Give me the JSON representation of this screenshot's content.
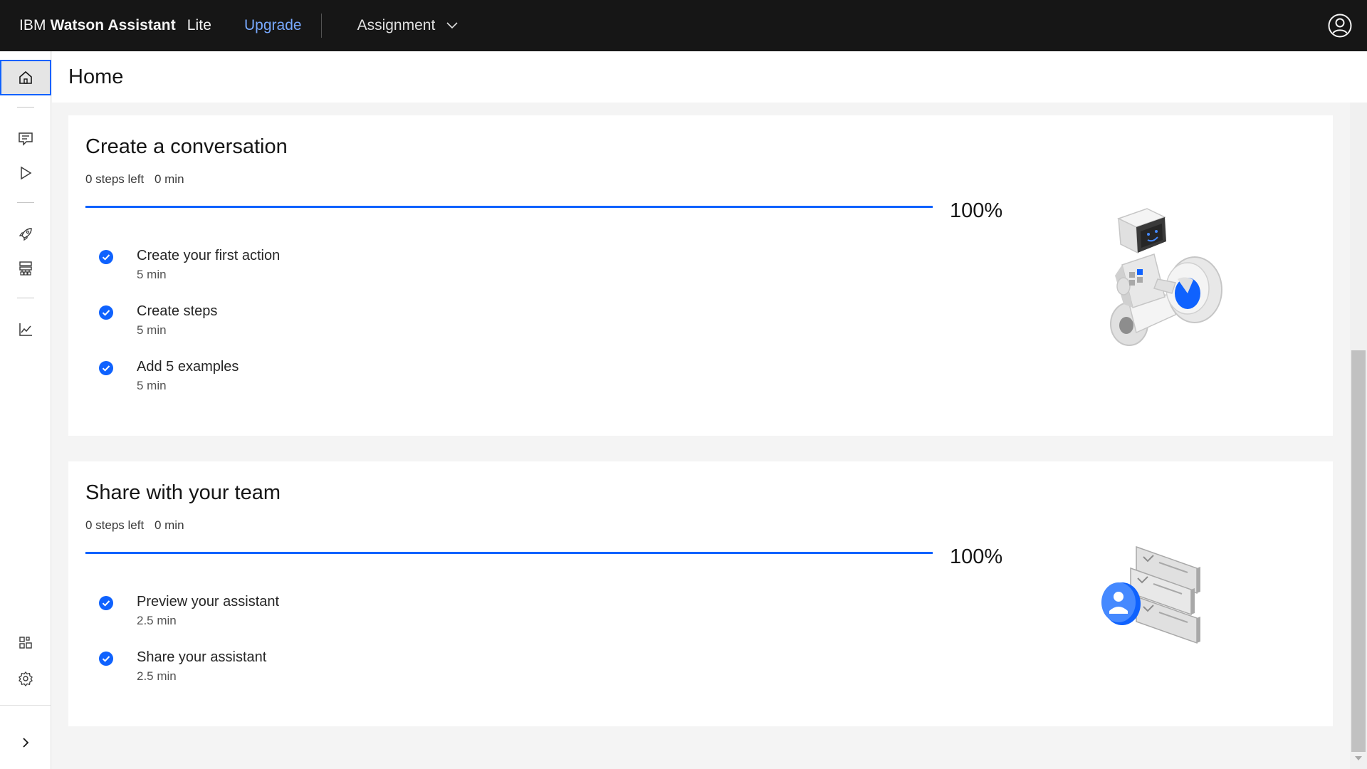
{
  "header": {
    "brand_prefix": "IBM",
    "brand_name": "Watson Assistant",
    "plan": "Lite",
    "upgrade_label": "Upgrade",
    "assistant_name": "Assignment"
  },
  "page": {
    "title": "Home"
  },
  "cards": [
    {
      "title": "Create a conversation",
      "steps_left": "0 steps left",
      "time_left": "0 min",
      "progress": 1.0,
      "progress_label": "100%",
      "tasks": [
        {
          "label": "Create your first action",
          "time": "5 min"
        },
        {
          "label": "Create steps",
          "time": "5 min"
        },
        {
          "label": "Add 5 examples",
          "time": "5 min"
        }
      ]
    },
    {
      "title": "Share with your team",
      "steps_left": "0 steps left",
      "time_left": "0 min",
      "progress": 1.0,
      "progress_label": "100%",
      "tasks": [
        {
          "label": "Preview your assistant",
          "time": "2.5 min"
        },
        {
          "label": "Share your assistant",
          "time": "2.5 min"
        }
      ]
    }
  ],
  "colors": {
    "accent": "#0f62fe",
    "header_bg": "#161616",
    "upgrade_link": "#78a9ff",
    "page_bg": "#f4f4f4"
  },
  "icons": {
    "sidenav": [
      "home-icon",
      "chat-icon",
      "play-icon",
      "rocket-icon",
      "hierarchy-icon",
      "analytics-icon",
      "integrations-icon",
      "settings-icon",
      "expand-chevron-icon"
    ],
    "header": [
      "chevron-down-icon",
      "user-avatar-icon"
    ]
  }
}
